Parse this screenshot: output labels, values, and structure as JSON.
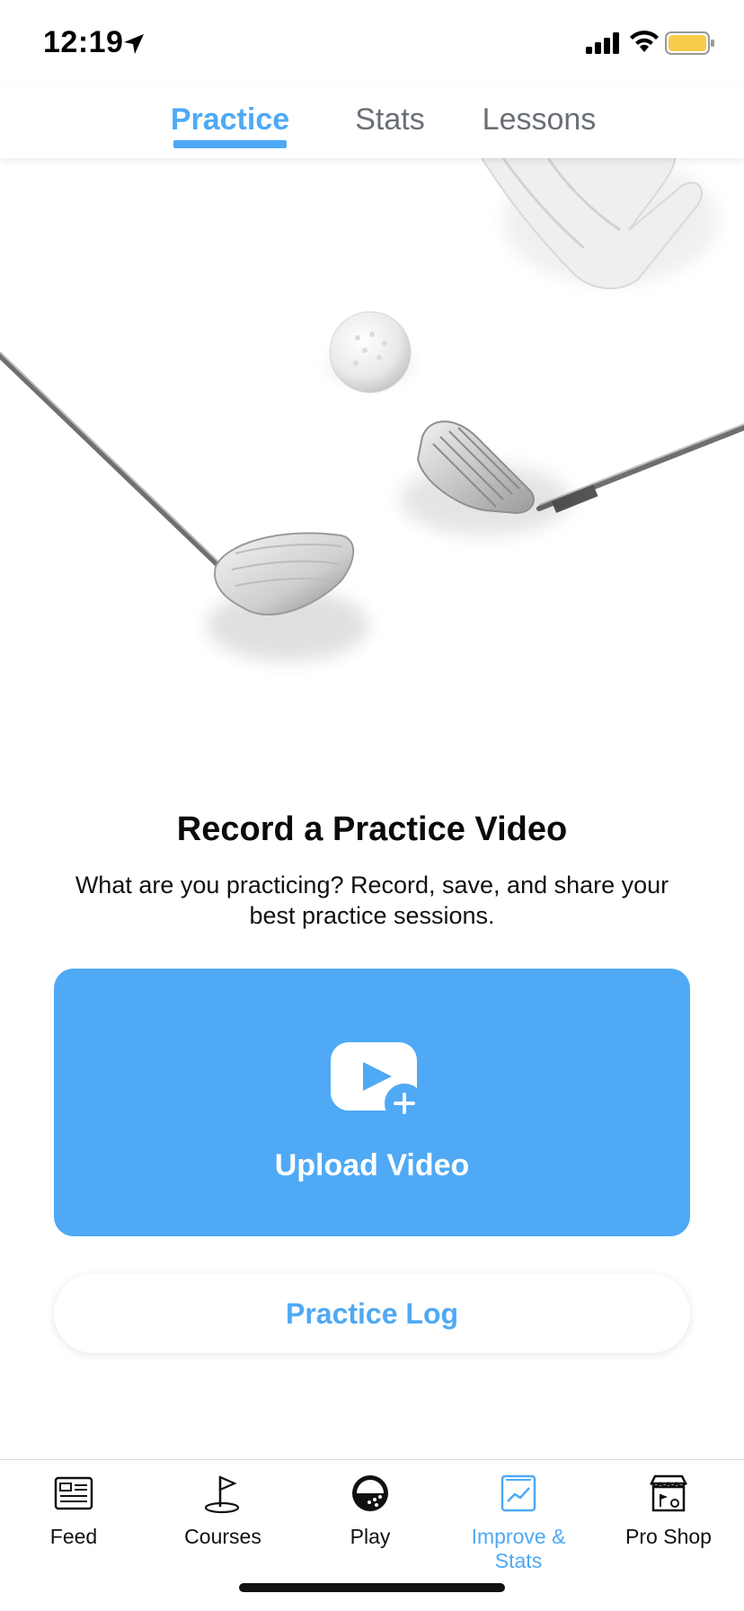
{
  "status_bar": {
    "time": "12:19",
    "battery_color": "#f6cc4a"
  },
  "top_tabs": [
    {
      "label": "Practice",
      "active": true
    },
    {
      "label": "Stats",
      "active": false
    },
    {
      "label": "Lessons",
      "active": false
    }
  ],
  "hero": {
    "headline": "Record a Practice Video",
    "description": "What are you practicing? Record, save, and share your best practice sessions."
  },
  "upload_button": {
    "label": "Upload Video",
    "icon": "video-add-icon"
  },
  "practice_log_button": {
    "label": "Practice Log"
  },
  "bottom_tabs": [
    {
      "label": "Feed",
      "icon": "feed-icon",
      "active": false
    },
    {
      "label": "Courses",
      "icon": "flag-icon",
      "active": false
    },
    {
      "label": "Play",
      "icon": "golf-ball-icon",
      "active": false
    },
    {
      "label": "Improve & Stats",
      "icon": "stats-chart-icon",
      "active": true
    },
    {
      "label": "Pro Shop",
      "icon": "shop-icon",
      "active": false
    }
  ],
  "colors": {
    "accent": "#4ea9f5",
    "upload_bg": "#4fa9f5",
    "text": "#111111"
  }
}
